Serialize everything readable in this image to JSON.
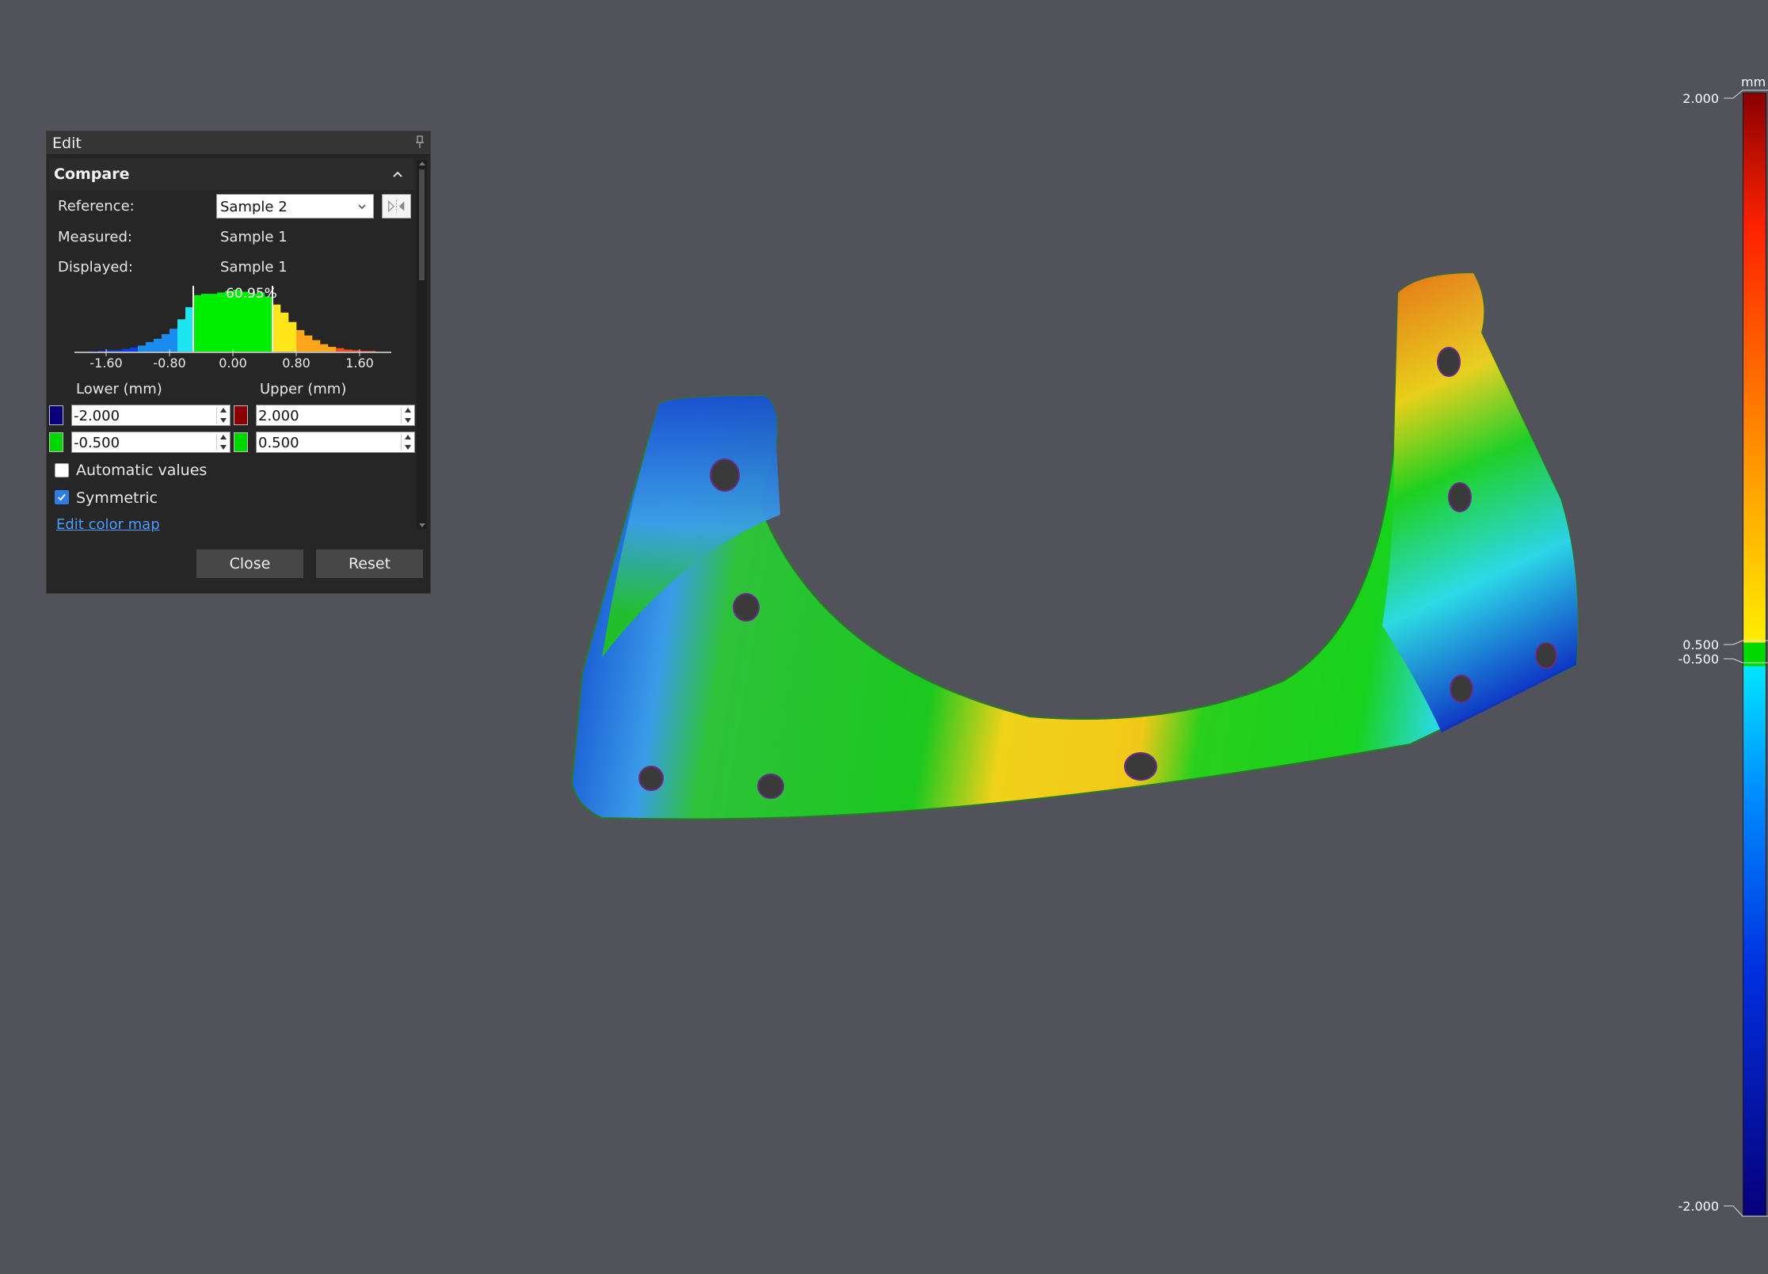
{
  "panel": {
    "title": "Edit",
    "section": "Compare",
    "reference_label": "Reference:",
    "reference_value": "Sample 2",
    "measured_label": "Measured:",
    "measured_value": "Sample 1",
    "displayed_label": "Displayed:",
    "displayed_value": "Sample 1",
    "lower_header": "Lower (mm)",
    "upper_header": "Upper (mm)",
    "lower_outer": "-2.000",
    "lower_inner": "-0.500",
    "upper_outer": "2.000",
    "upper_inner": "0.500",
    "automatic_values_label": "Automatic values",
    "automatic_values_checked": false,
    "symmetric_label": "Symmetric",
    "symmetric_checked": true,
    "edit_color_map_link": "Edit color map",
    "close_button": "Close",
    "reset_button": "Reset"
  },
  "chart_data": {
    "type": "bar",
    "title": "",
    "annotation": "60.95%",
    "x_tick_labels": [
      "-1.60",
      "-0.80",
      "0.00",
      "0.80",
      "1.60"
    ],
    "xlim": [
      -2.0,
      2.0
    ],
    "within_tolerance_percent": 60.95,
    "tolerance_band": [
      -0.5,
      0.5
    ],
    "bins_x": [
      -1.95,
      -1.85,
      -1.75,
      -1.65,
      -1.55,
      -1.45,
      -1.35,
      -1.25,
      -1.15,
      -1.05,
      -0.95,
      -0.85,
      -0.75,
      -0.65,
      -0.55,
      -0.45,
      -0.35,
      -0.25,
      -0.15,
      -0.05,
      0.05,
      0.15,
      0.25,
      0.35,
      0.45,
      0.55,
      0.65,
      0.75,
      0.85,
      0.95,
      1.05,
      1.15,
      1.25,
      1.35,
      1.45,
      1.55,
      1.65,
      1.75,
      1.85,
      1.95
    ],
    "values": [
      0,
      0,
      1,
      1,
      2,
      2,
      4,
      6,
      9,
      14,
      19,
      26,
      34,
      48,
      66,
      84,
      86,
      86,
      88,
      90,
      92,
      89,
      86,
      88,
      82,
      70,
      58,
      44,
      32,
      24,
      17,
      11,
      7,
      5,
      3,
      2,
      1,
      1,
      0,
      0
    ]
  },
  "scale": {
    "unit": "mm",
    "max_label": "2.000",
    "upper_tol_label": "0.500",
    "lower_tol_label": "-0.500",
    "min_label": "-2.000",
    "colors": {
      "max": "#8b0000",
      "upper_tol": "#ffee00",
      "tol_band": "#00d800",
      "lower_tol": "#00e5ff",
      "min": "#08007a"
    }
  }
}
